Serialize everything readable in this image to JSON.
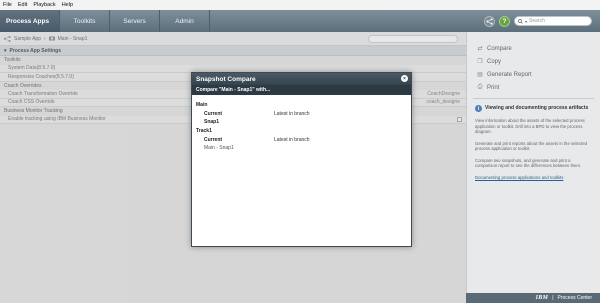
{
  "menubar": [
    "File",
    "Edit",
    "Playback",
    "Help"
  ],
  "nav": {
    "tabs": [
      "Process Apps",
      "Toolkits",
      "Servers",
      "Admin"
    ],
    "help_glyph": "?",
    "search_placeholder": "Search"
  },
  "breadcrumb": {
    "app": "Sample App",
    "snapshot": "Main - Snap1"
  },
  "settings": {
    "header": "Process App Settings",
    "rows": [
      {
        "kind": "section",
        "label": "Toolkits",
        "value": ""
      },
      {
        "kind": "item",
        "label": "System Data(8.5.7.0)",
        "value": ""
      },
      {
        "kind": "item",
        "label": "Responsive Coaches(8.5.7.0)",
        "value": ""
      },
      {
        "kind": "section",
        "label": "Coach Overrides",
        "value": ""
      },
      {
        "kind": "item",
        "label": "Coach Transformation Override",
        "value": "CoachDesigne"
      },
      {
        "kind": "item",
        "label": "Coach CSS Override",
        "value": "coach_designe"
      },
      {
        "kind": "section",
        "label": "Business Monitor Tracking",
        "value": ""
      },
      {
        "kind": "item",
        "label": "Enable tracking using IBM Business Monitor",
        "value": "",
        "checkbox": true
      }
    ]
  },
  "right_panel": {
    "actions": [
      "Compare",
      "Copy",
      "Generate Report",
      "Print"
    ],
    "info_title": "Viewing and documenting process artifacts",
    "paragraphs": [
      "View information about the assets of the selected process application or toolkit. Drill into a BPD to view the process diagram.",
      "Generate and print reports about the assets in the selected process application or toolkit.",
      "Compare two snapshots, and generate and print a comparison report to see the differences between them."
    ],
    "link": "Documenting process applications and toolkits"
  },
  "footer": {
    "brand": "IBM",
    "product": "Process Center"
  },
  "modal": {
    "title": "Snapshot Compare",
    "close_glyph": "×",
    "subtitle": "Compare \"Main - Snap1\" with...",
    "groups": [
      {
        "name": "Main",
        "rows": [
          {
            "k": "Current",
            "v": "Latest in branch",
            "bold": true
          },
          {
            "k": "Snap1",
            "v": "",
            "bold": true
          }
        ]
      },
      {
        "name": "Track1",
        "rows": [
          {
            "k": "Current",
            "v": "Latest in branch",
            "bold": true
          },
          {
            "k": "Main - Snap1",
            "v": "",
            "bold": false
          }
        ]
      }
    ]
  },
  "colors": {
    "nav_bg": "#6c7e89",
    "modal_title_bg": "#3f4e59",
    "link": "#2b5e94",
    "help_green": "#6ba14a"
  }
}
